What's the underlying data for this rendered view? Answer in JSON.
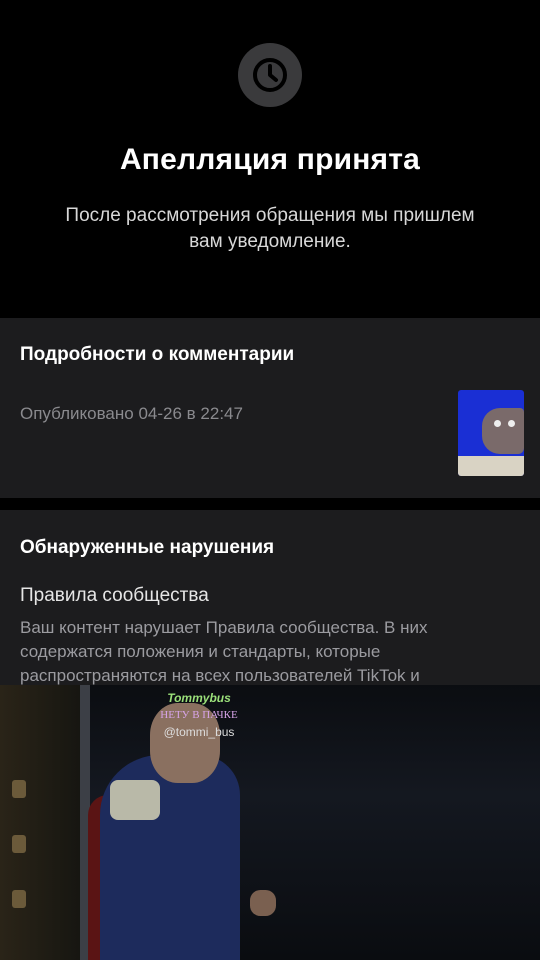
{
  "header": {
    "icon": "clock-icon",
    "title": "Апелляция принята",
    "subtitle": "После рассмотрения обращения мы пришлем вам уведомление."
  },
  "comment_details": {
    "heading": "Подробности о комментарии",
    "published": "Опубликовано 04-26 в 22:47"
  },
  "violations": {
    "heading": "Обнаруженные нарушения",
    "rule_title": "Правила сообщества",
    "rule_description": "Ваш контент нарушает Правила сообщества. В них содержатся положения и стандарты, которые распространяются на всех пользователей TikTok и"
  },
  "watermark": {
    "brand": "Tommybus",
    "tag": "НЕТУ В ПАЧКЕ",
    "user": "@tommi_bus"
  },
  "colors": {
    "background": "#000000",
    "card": "#1c1c1e",
    "muted_text": "#8a8a8e",
    "thumbnail_bg": "#1a2fd4"
  }
}
